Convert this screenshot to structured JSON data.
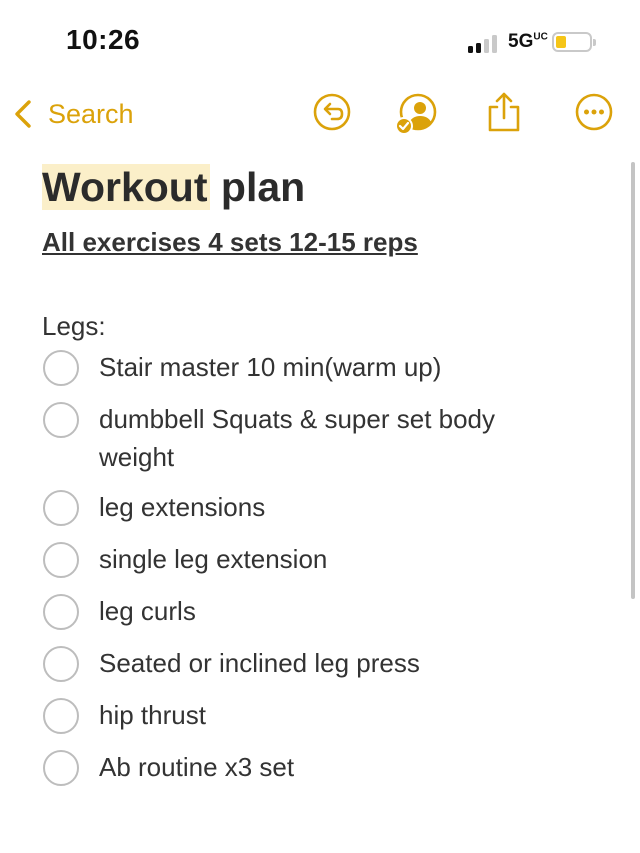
{
  "status_bar": {
    "time": "10:26",
    "network": "5G",
    "network_suffix": "UC",
    "battery_color": "#f5c518"
  },
  "nav": {
    "back_label": "Search",
    "back_icon": "chevron-left-icon",
    "icons": [
      "undo-icon",
      "shared-person-icon",
      "share-icon",
      "more-icon"
    ],
    "accent": "#dba20a"
  },
  "note": {
    "title_highlighted": "Workout",
    "title_rest": " plan",
    "subtitle": "All exercises 4 sets 12-15 reps",
    "section": "Legs:",
    "items": [
      {
        "text": "Stair master 10 min(warm up)",
        "checked": false
      },
      {
        "text": "dumbbell Squats & super set body weight",
        "checked": false
      },
      {
        "text": "leg extensions",
        "checked": false
      },
      {
        "text": "single leg extension",
        "checked": false
      },
      {
        "text": "leg curls",
        "checked": false
      },
      {
        "text": "Seated or inclined leg press",
        "checked": false
      },
      {
        "text": "hip thrust",
        "checked": false
      },
      {
        "text": "Ab routine x3 set",
        "checked": false
      }
    ]
  }
}
